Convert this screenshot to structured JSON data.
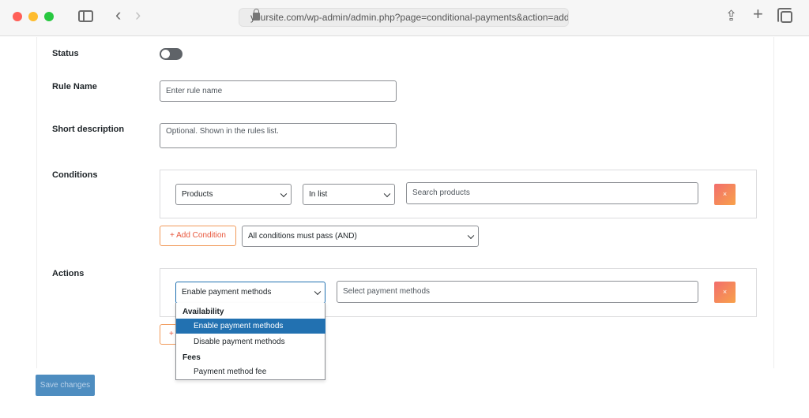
{
  "browser": {
    "url": "yoursite.com/wp-admin/admin.php?page=conditional-payments&action=add"
  },
  "form": {
    "status_label": "Status",
    "status_enabled": false,
    "rule_name_label": "Rule Name",
    "rule_name_placeholder": "Enter rule name",
    "short_description_label": "Short description",
    "short_description_placeholder": "Optional. Shown in the rules list.",
    "conditions_label": "Conditions",
    "actions_label": "Actions"
  },
  "conditions": {
    "rows": [
      {
        "subject": "Products",
        "operator": "In list",
        "value_placeholder": "Search products",
        "remove_label": "×"
      }
    ],
    "add_label": "+ Add Condition",
    "logic": "All conditions must pass (AND)"
  },
  "actions": {
    "rows": [
      {
        "action": "Enable payment methods",
        "value_placeholder": "Select payment methods",
        "remove_label": "×"
      }
    ],
    "add_label_partial": "+",
    "dropdown": {
      "groups": [
        {
          "label": "Availability",
          "options": [
            "Enable payment methods",
            "Disable payment methods"
          ]
        },
        {
          "label": "Fees",
          "options": [
            "Payment method fee"
          ]
        }
      ],
      "selected": "Enable payment methods"
    }
  },
  "footer": {
    "save_label": "Save changes"
  },
  "colors": {
    "primary": "#2271b1",
    "remove_gradient_start": "#f26d6d",
    "remove_gradient_end": "#f8a24a",
    "add_button_text": "#e8553a"
  }
}
